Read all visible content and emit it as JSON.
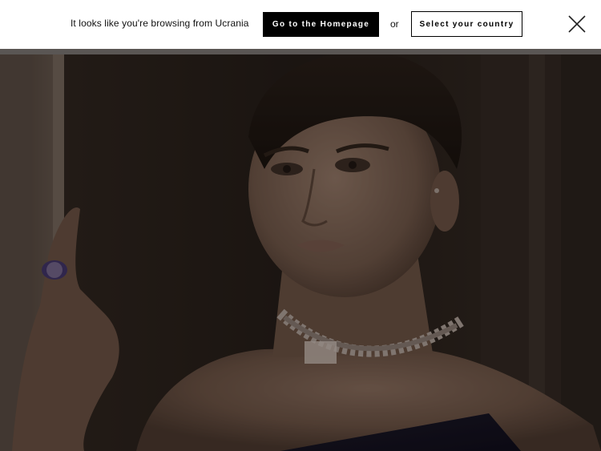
{
  "geo_banner": {
    "message": "It looks like you're browsing from Ucrania",
    "homepage_button_label": "Go to the Homepage",
    "separator": "or",
    "country_button_label": "Select your country",
    "close_icon": "close-icon"
  },
  "hero": {
    "image_subject": "hero-photo"
  },
  "colors": {
    "banner_bg": "#ffffff",
    "primary_button_bg": "#000000",
    "primary_button_text": "#ffffff",
    "secondary_button_border": "#000000",
    "hero_tint": "#2a211c"
  }
}
